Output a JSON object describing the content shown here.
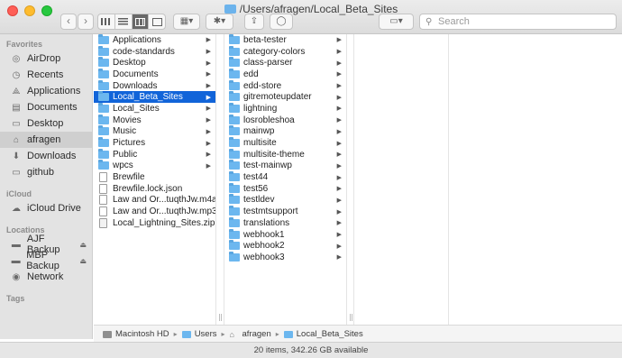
{
  "window": {
    "title": "/Users/afragen/Local_Beta_Sites"
  },
  "toolbar": {
    "back_icon": "chevron-left-icon",
    "forward_icon": "chevron-right-icon",
    "views": [
      "icon-view",
      "list-view",
      "column-view",
      "gallery-view"
    ],
    "active_view": "column-view",
    "search_placeholder": "Search"
  },
  "sidebar": {
    "favorites_header": "Favorites",
    "favorites": [
      {
        "label": "AirDrop",
        "icon": "airdrop-icon"
      },
      {
        "label": "Recents",
        "icon": "clock-icon"
      },
      {
        "label": "Applications",
        "icon": "applications-icon"
      },
      {
        "label": "Documents",
        "icon": "document-icon"
      },
      {
        "label": "Desktop",
        "icon": "desktop-icon"
      },
      {
        "label": "afragen",
        "icon": "home-icon",
        "selected": true
      },
      {
        "label": "Downloads",
        "icon": "download-icon"
      },
      {
        "label": "github",
        "icon": "folder-icon"
      }
    ],
    "icloud_header": "iCloud",
    "icloud": [
      {
        "label": "iCloud Drive",
        "icon": "cloud-icon"
      }
    ],
    "locations_header": "Locations",
    "locations": [
      {
        "label": "AJF Backup",
        "icon": "drive-icon"
      },
      {
        "label": "MBP Backup",
        "icon": "drive-icon"
      },
      {
        "label": "Network",
        "icon": "network-icon"
      }
    ],
    "tags_header": "Tags"
  },
  "columns": {
    "col1": [
      {
        "name": "Applications",
        "type": "folder"
      },
      {
        "name": "code-standards",
        "type": "folder"
      },
      {
        "name": "Desktop",
        "type": "folder"
      },
      {
        "name": "Documents",
        "type": "folder"
      },
      {
        "name": "Downloads",
        "type": "folder"
      },
      {
        "name": "Local_Beta_Sites",
        "type": "folder",
        "selected": true
      },
      {
        "name": "Local_Sites",
        "type": "folder"
      },
      {
        "name": "Movies",
        "type": "folder"
      },
      {
        "name": "Music",
        "type": "folder"
      },
      {
        "name": "Pictures",
        "type": "folder"
      },
      {
        "name": "Public",
        "type": "folder"
      },
      {
        "name": "wpcs",
        "type": "folder"
      },
      {
        "name": "Brewfile",
        "type": "doc"
      },
      {
        "name": "Brewfile.lock.json",
        "type": "doc"
      },
      {
        "name": "Law and Or...tuqthJw.m4a",
        "type": "doc"
      },
      {
        "name": "Law and Or...tuqthJw.mp3",
        "type": "doc"
      },
      {
        "name": "Local_Lightning_Sites.zip",
        "type": "zip"
      }
    ],
    "col2": [
      "beta-tester",
      "category-colors",
      "class-parser",
      "edd",
      "edd-store",
      "gitremoteupdater",
      "lightning",
      "losrobleshoa",
      "mainwp",
      "multisite",
      "multisite-theme",
      "test-mainwp",
      "test44",
      "test56",
      "testldev",
      "testmtsupport",
      "translations",
      "webhook1",
      "webhook2",
      "webhook3"
    ]
  },
  "pathbar": [
    "Macintosh HD",
    "Users",
    "afragen",
    "Local_Beta_Sites"
  ],
  "status": "20 items, 342.26 GB available"
}
